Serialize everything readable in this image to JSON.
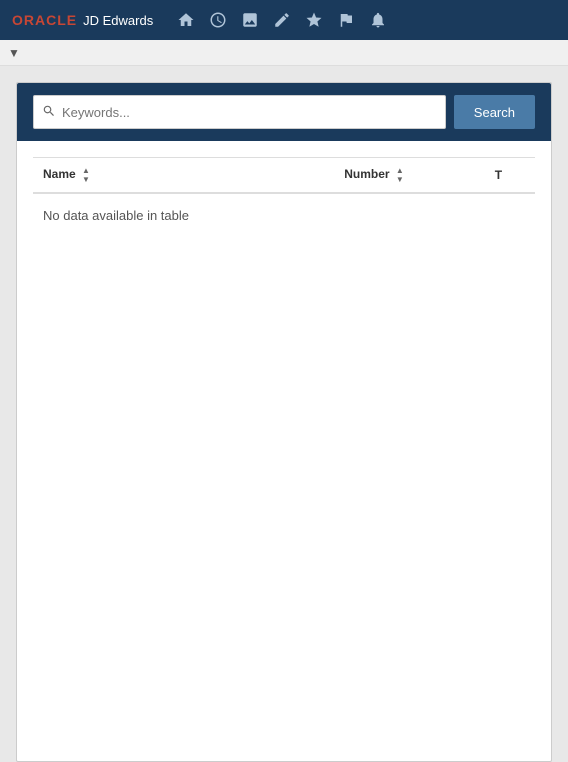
{
  "app": {
    "title": "JD Edwards"
  },
  "navbar": {
    "oracle_text": "ORACLE",
    "jde_text": "JD Edwards",
    "icons": [
      {
        "name": "home-icon",
        "symbol": "⌂"
      },
      {
        "name": "clock-icon",
        "symbol": "🕐"
      },
      {
        "name": "image-icon",
        "symbol": "▣"
      },
      {
        "name": "edit-icon",
        "symbol": "✎"
      },
      {
        "name": "star-icon",
        "symbol": "★"
      },
      {
        "name": "flag-icon",
        "symbol": "⚑"
      },
      {
        "name": "bell-icon",
        "symbol": "🔔"
      }
    ]
  },
  "secondary_bar": {
    "menu_arrow": "▼"
  },
  "search": {
    "placeholder": "Keywords...",
    "button_label": "Search"
  },
  "table": {
    "columns": [
      {
        "key": "name",
        "label": "Name",
        "sortable": true
      },
      {
        "key": "number",
        "label": "Number",
        "sortable": true
      },
      {
        "key": "t",
        "label": "T",
        "sortable": false
      }
    ],
    "empty_message": "No data available in table"
  }
}
